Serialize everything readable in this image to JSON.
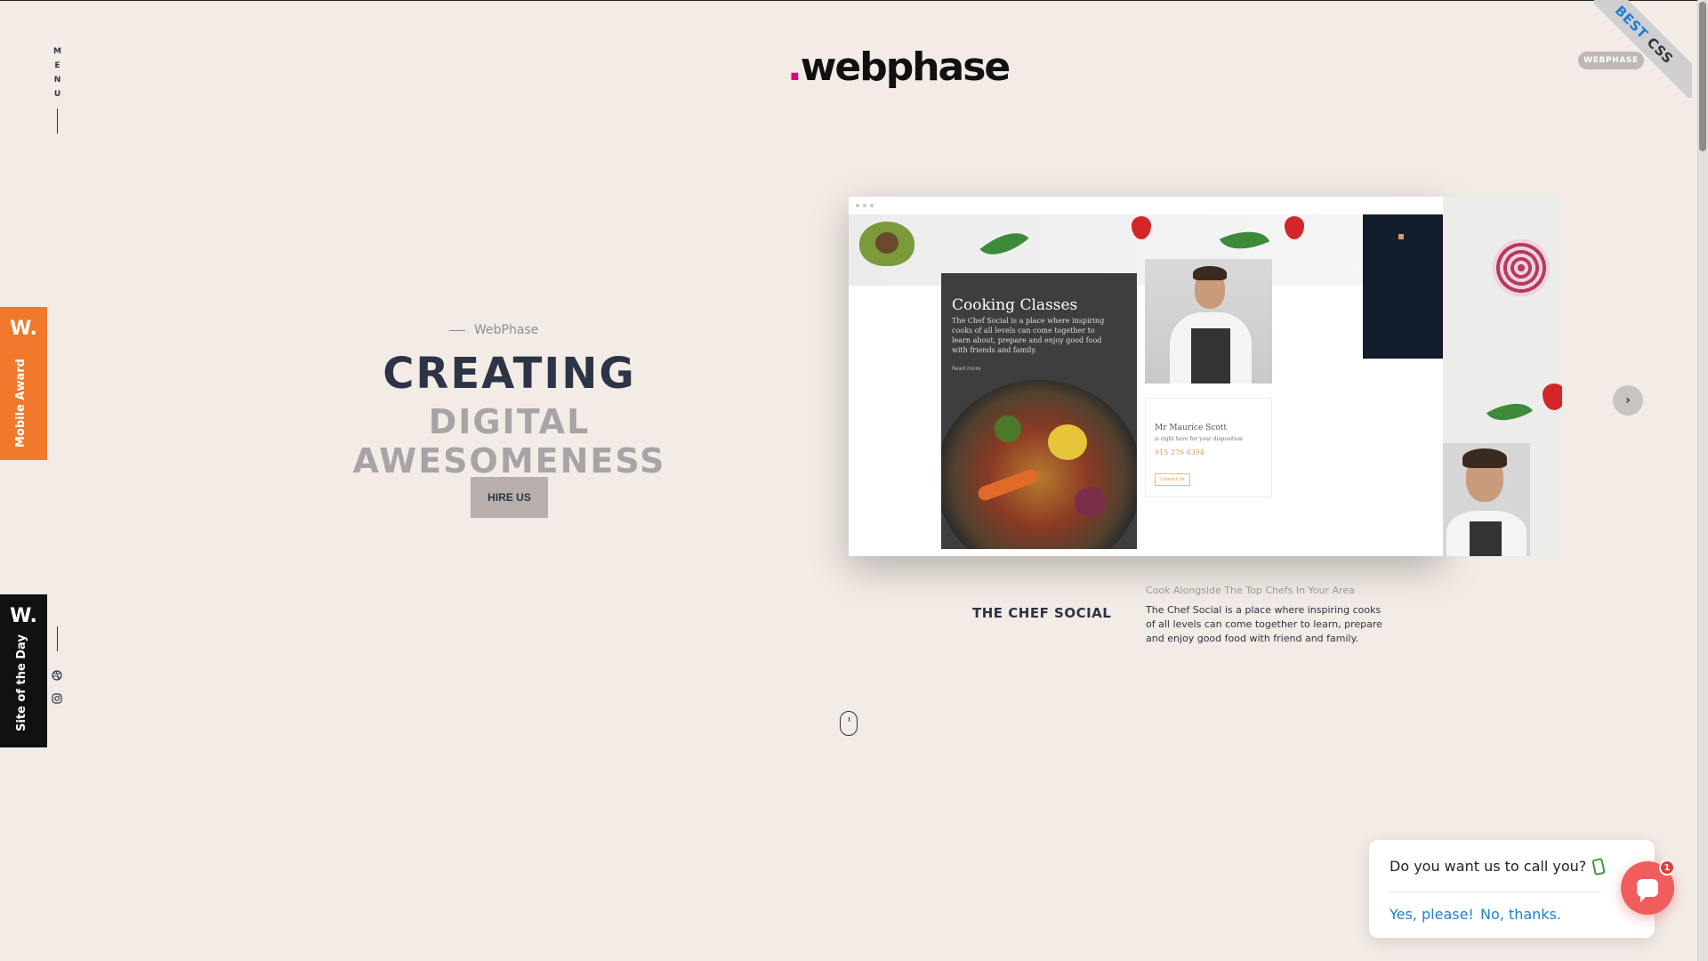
{
  "menu": {
    "letters": [
      "M",
      "E",
      "N",
      "U"
    ]
  },
  "logo": {
    "dot": ".",
    "text": "webphase"
  },
  "top_badge": "WEBPHASE",
  "ribbon": {
    "best": "BEST",
    "css": "CSS"
  },
  "awards": {
    "mobile": {
      "mark": "W.",
      "label": "Mobile Award"
    },
    "sotd": {
      "mark": "W.",
      "label": "Site of the Day"
    }
  },
  "social": {
    "icons": [
      "dribbble-icon",
      "instagram-icon"
    ]
  },
  "hero": {
    "kicker": "WebPhase",
    "title": "CREATING",
    "subtitle": "DIGITAL AWESOMENESS",
    "cta": "HIRE US"
  },
  "showcase": {
    "card_title": "Cooking Classes",
    "card_text": "The Chef Social is a place where inspiring cooks of all levels can come together to learn about, prepare and enjoy good food with friends and family.",
    "card_more": "Read more",
    "contact_name": "Mr Maurice Scott",
    "contact_sub": "is right here for your disposition",
    "contact_phone": "915 276 6394",
    "contact_btn": "Contact Us"
  },
  "project": {
    "name": "THE CHEF SOCIAL",
    "tag": "Cook Alongside The Top Chefs In Your Area",
    "description": "The Chef Social is a place where inspiring cooks of all levels can come together to learn, prepare and enjoy good food with friend and family."
  },
  "carousel": {
    "next": "›"
  },
  "chat": {
    "question": "Do you want us to call you?",
    "yes": "Yes, please!",
    "no": "No, thanks.",
    "count": "1"
  },
  "colors": {
    "background": "#f3ebe5",
    "navy": "#2c3446",
    "accent_pink": "#e5007a",
    "award_orange": "#f0792b",
    "chat_red": "#f15c5c",
    "link_blue": "#1e7fd1"
  }
}
